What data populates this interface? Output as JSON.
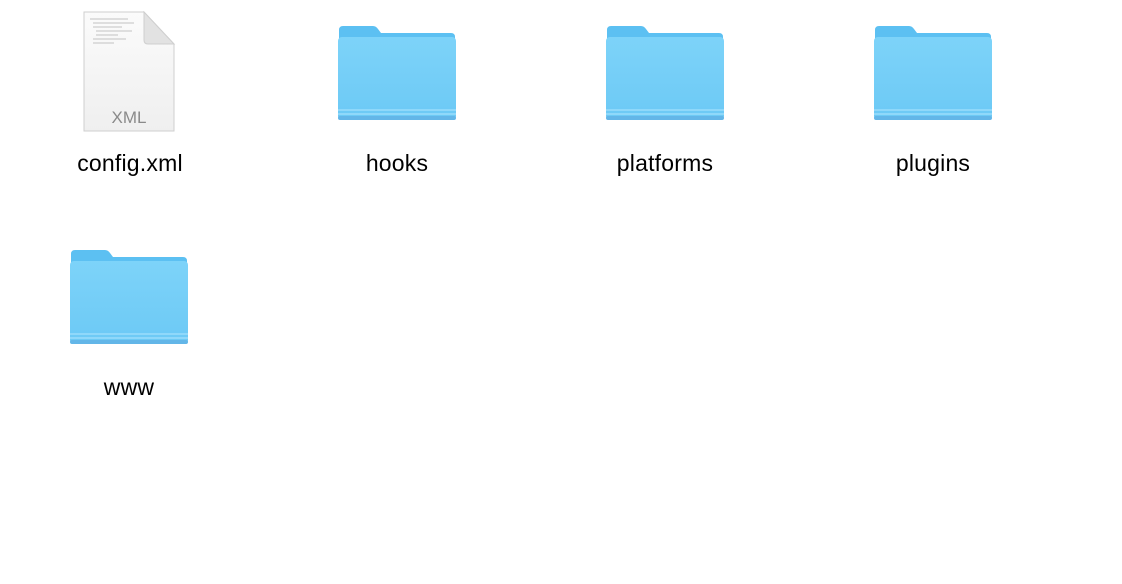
{
  "window": {
    "view": "icon-view"
  },
  "colors": {
    "folder_body": "#72cdf7",
    "folder_tab": "#5cc0f2",
    "folder_edge": "#63b6e8",
    "document_page": "#f6f6f6",
    "document_badge_text": "#8a8a8a"
  },
  "items": [
    {
      "name": "config.xml",
      "kind": "document",
      "icon": "xml-document-icon",
      "badge": "XML"
    },
    {
      "name": "hooks",
      "kind": "folder",
      "icon": "folder-icon"
    },
    {
      "name": "platforms",
      "kind": "folder",
      "icon": "folder-icon"
    },
    {
      "name": "plugins",
      "kind": "folder",
      "icon": "folder-icon"
    },
    {
      "name": "www",
      "kind": "folder",
      "icon": "folder-icon"
    }
  ]
}
